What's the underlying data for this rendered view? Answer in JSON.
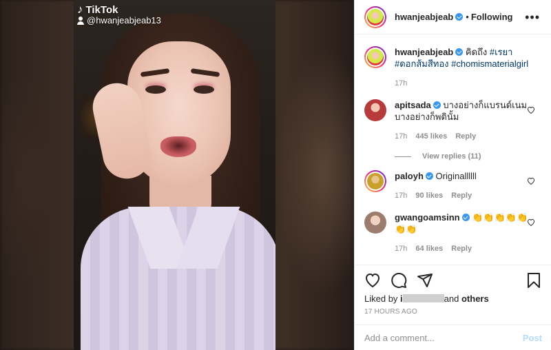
{
  "media": {
    "watermark_brand": "TikTok",
    "watermark_user": "@hwanjeabjeab13"
  },
  "header": {
    "username": "hwanjeabjeab",
    "separator": "•",
    "follow_status": "Following",
    "more_icon": "more-horizontal-icon"
  },
  "caption": {
    "username": "hwanjeabjeab",
    "text_plain": "คิดถึง ",
    "hashtags": [
      "#เรยา",
      "#ดอกส้มสีทอง",
      "#chomismaterialgirl"
    ],
    "time": "17h"
  },
  "comments": [
    {
      "username": "apitsada",
      "verified": true,
      "text": "บางอย่างก็แบรนด์เนม บางอย่างก็พดินั้ม",
      "time": "17h",
      "likes": "445 likes",
      "reply": "Reply",
      "avatar_color": "#b73b3b"
    },
    {
      "username": "paloyh",
      "verified": true,
      "text": "Originallllll",
      "time": "17h",
      "likes": "90 likes",
      "reply": "Reply",
      "avatar_color": "#c9a02a"
    },
    {
      "username": "gwangoamsinn",
      "verified": true,
      "text": "👏👏👏👏👏👏👏",
      "time": "17h",
      "likes": "64 likes",
      "reply": "Reply",
      "avatar_color": "#9c7d6d"
    }
  ],
  "view_replies": "View replies (11)",
  "actions": {
    "icons": [
      "heart-icon",
      "comment-icon",
      "share-icon",
      "bookmark-icon"
    ]
  },
  "likes": {
    "prefix": "Liked by ",
    "partial_user": "i",
    "mid": "and ",
    "others": "others"
  },
  "timestamp": "17 HOURS AGO",
  "add_comment": {
    "placeholder": "Add a comment...",
    "post_label": "Post"
  },
  "colors": {
    "link": "#00376b",
    "verified": "#3897f0",
    "muted": "#8e8e8e",
    "post_disabled": "#b3dbff"
  }
}
